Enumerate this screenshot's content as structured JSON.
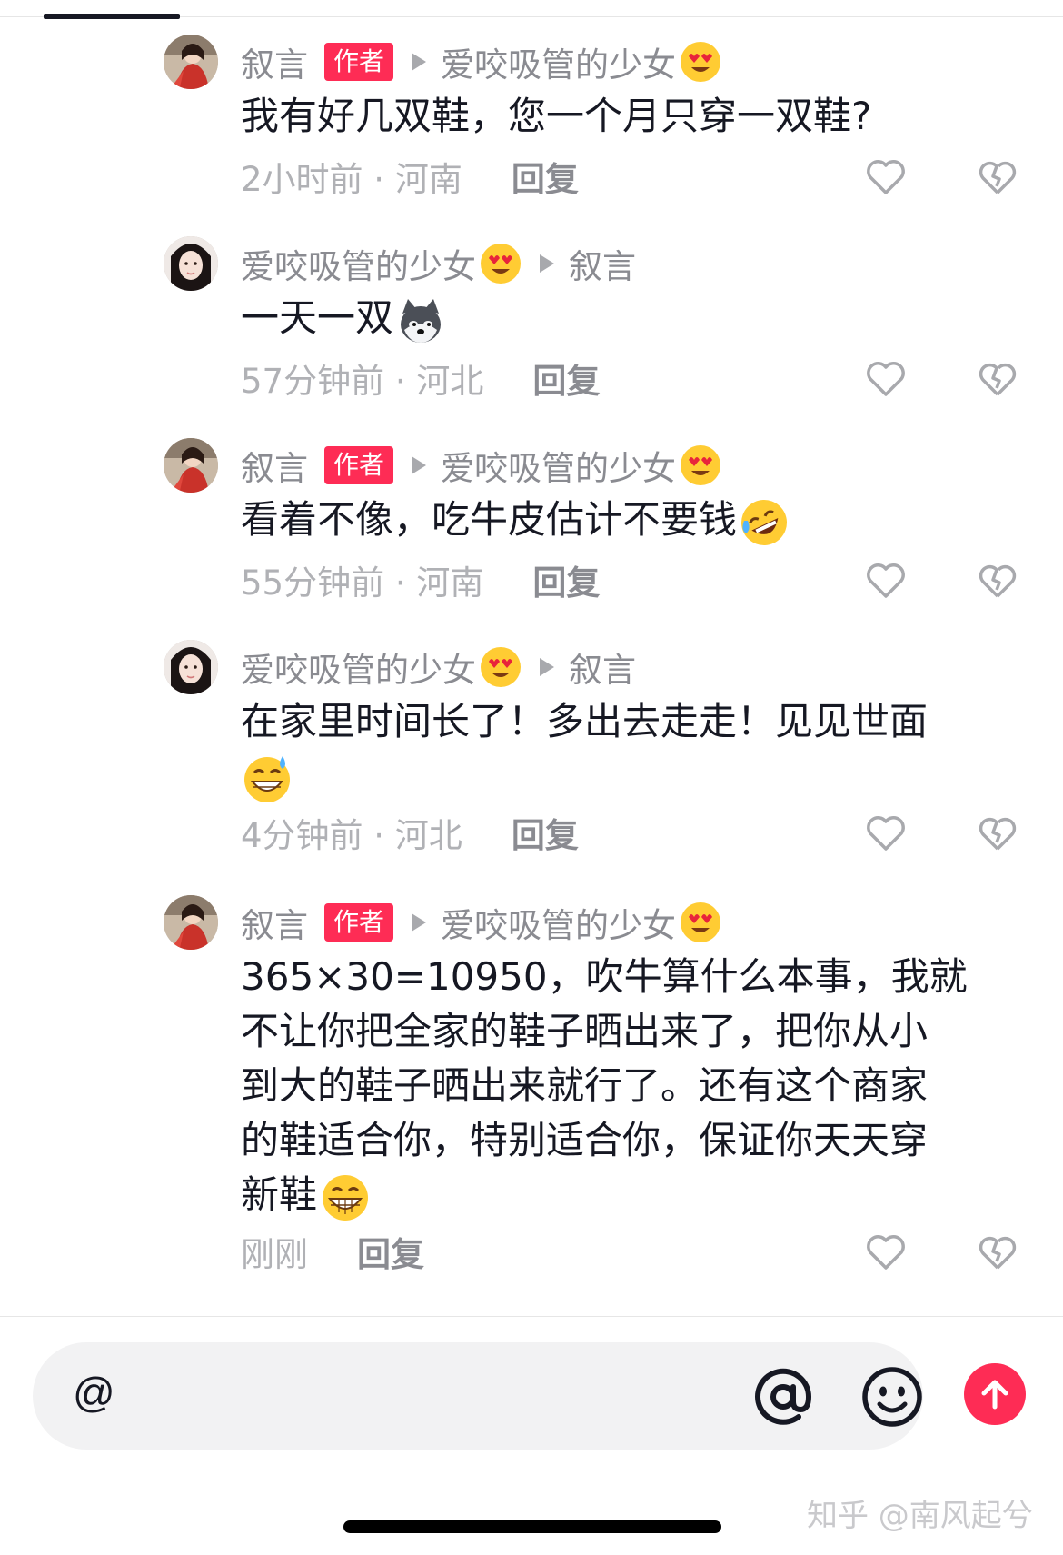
{
  "author_badge": "作者",
  "comments": [
    {
      "user": "叙言",
      "is_author": true,
      "reply_to": "爱咬吸管的少女",
      "reply_to_emoji": "heart-eyes",
      "lines": [
        "我有好几双鞋，您一个月只穿一双鞋?"
      ],
      "time_location": "2小时前 · 河南",
      "reply_label": "回复"
    },
    {
      "user": "爱咬吸管的少女",
      "user_emoji": "heart-eyes",
      "is_author": false,
      "reply_to": "叙言",
      "lines": [
        "一天一双"
      ],
      "trailing_emoji": "husky-dog",
      "time_location": "57分钟前 · 河北",
      "reply_label": "回复"
    },
    {
      "user": "叙言",
      "is_author": true,
      "reply_to": "爱咬吸管的少女",
      "reply_to_emoji": "heart-eyes",
      "lines": [
        "看着不像，吃牛皮估计不要钱"
      ],
      "trailing_emoji": "rolling-laughing",
      "time_location": "55分钟前 · 河南",
      "reply_label": "回复"
    },
    {
      "user": "爱咬吸管的少女",
      "user_emoji": "heart-eyes",
      "is_author": false,
      "reply_to": "叙言",
      "lines": [
        "在家里时间长了！多出去走走！见见世面"
      ],
      "trailing_emoji": "grin-sweat",
      "time_location": "4分钟前 · 河北",
      "reply_label": "回复"
    },
    {
      "user": "叙言",
      "is_author": true,
      "reply_to": "爱咬吸管的少女",
      "reply_to_emoji": "heart-eyes",
      "lines": [
        "365×30=10950，吹牛算什么本事，我就",
        "不让你把全家的鞋子晒出来了，把你从小",
        "到大的鞋子晒出来就行了。还有这个商家",
        "的鞋适合你，特别适合你，保证你天天穿",
        "新鞋"
      ],
      "trailing_emoji": "grin",
      "time_location": "刚刚",
      "reply_label": "回复"
    }
  ],
  "input": {
    "placeholder": "@",
    "at_icon": "at-icon",
    "emoji_icon": "smiley-face-icon",
    "send_icon": "arrow-up-icon"
  },
  "watermark": "知乎 @南风起兮",
  "colors": {
    "accent": "#fe2c55",
    "secondary_text": "#8a8b91",
    "muted_text": "#b0b1b5",
    "input_bg": "#f2f2f3"
  }
}
